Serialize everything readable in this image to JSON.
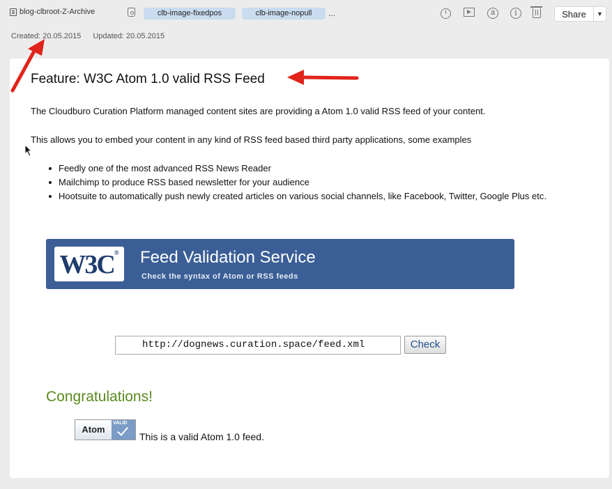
{
  "toolbar": {
    "notebook_name": "blog-clbroot-Z-Archive",
    "tags": [
      "clb-image-fixedpos",
      "clb-image-nopull"
    ],
    "more_tags": "...",
    "icons": [
      "reminder-icon",
      "present-icon",
      "at-icon",
      "info-icon",
      "trash-icon"
    ],
    "share_label": "Share"
  },
  "meta": {
    "created": "Created: 20.05.2015",
    "updated": "Updated: 20.05.2015"
  },
  "note": {
    "title": "Feature: W3C Atom 1.0 valid RSS Feed",
    "paragraph1": "The Cloudburo Curation Platform managed content sites are providing a Atom 1.0 valid RSS feed of your content.",
    "paragraph2": "This allows you to embed your content in any kind of RSS feed based third party applications, some examples",
    "bullets": [
      "Feedly one of the most advanced RSS News Reader",
      "Mailchimp to produce RSS based newsletter for your audience",
      "Hootsuite to automatically push newly created articles on various social channels, like Facebook, Twitter, Google Plus etc."
    ],
    "banner": {
      "logo": "W3C",
      "title": "Feed Validation Service",
      "subtitle": "Check the syntax of Atom or RSS feeds"
    },
    "validator": {
      "url": "http://dognews.curation.space/feed.xml",
      "check_label": "Check"
    },
    "result": {
      "heading": "Congratulations!",
      "badge_label": "Atom",
      "badge_valid": "VALID",
      "message": "This is a valid Atom 1.0 feed."
    }
  },
  "colors": {
    "banner": "#3b5e96",
    "tag": "#c9dcf0",
    "congrats": "#5a8a1e",
    "annotation_arrow": "#e0241b"
  }
}
